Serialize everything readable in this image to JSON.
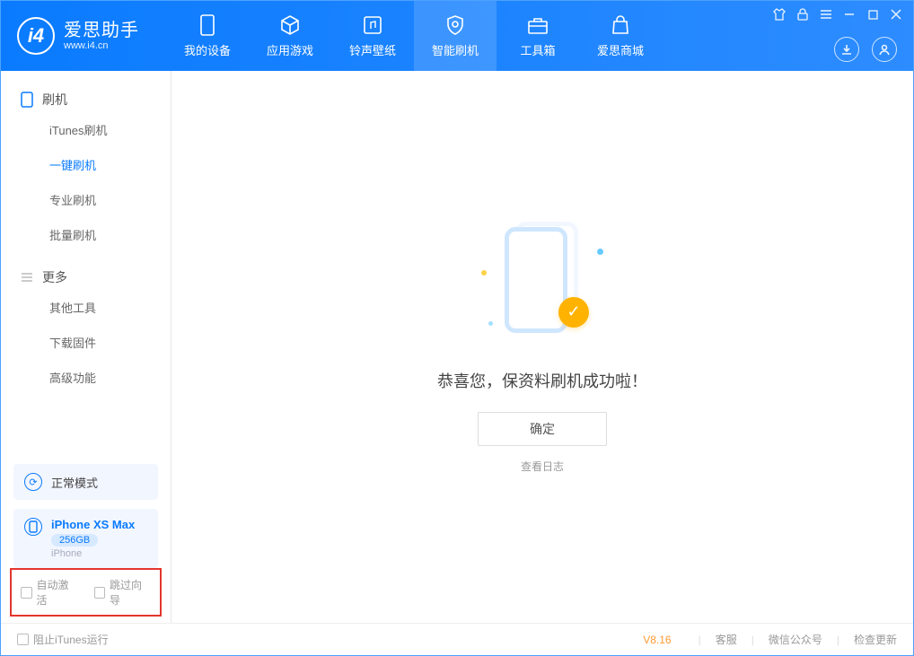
{
  "app": {
    "title": "爱思助手",
    "site": "www.i4.cn"
  },
  "nav": {
    "items": [
      {
        "label": "我的设备"
      },
      {
        "label": "应用游戏"
      },
      {
        "label": "铃声壁纸"
      },
      {
        "label": "智能刷机"
      },
      {
        "label": "工具箱"
      },
      {
        "label": "爱思商城"
      }
    ]
  },
  "sidebar": {
    "flash_section": "刷机",
    "flash_items": [
      "iTunes刷机",
      "一键刷机",
      "专业刷机",
      "批量刷机"
    ],
    "more_section": "更多",
    "more_items": [
      "其他工具",
      "下载固件",
      "高级功能"
    ],
    "mode_label": "正常模式",
    "device": {
      "name": "iPhone XS Max",
      "capacity": "256GB",
      "type": "iPhone"
    },
    "check_auto_activate": "自动激活",
    "check_skip_guide": "跳过向导"
  },
  "main": {
    "success_msg": "恭喜您，保资料刷机成功啦！",
    "ok_btn": "确定",
    "view_log": "查看日志"
  },
  "footer": {
    "block_itunes": "阻止iTunes运行",
    "version": "V8.16",
    "support": "客服",
    "wechat": "微信公众号",
    "update": "检查更新"
  }
}
